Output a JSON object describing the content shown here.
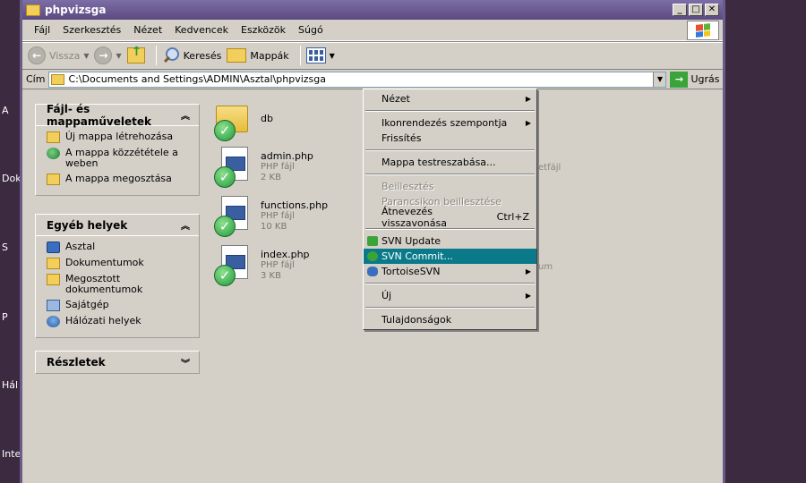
{
  "window": {
    "title": "phpvizsga"
  },
  "desktop_labels": [
    "A",
    "Dok",
    "S",
    "P",
    "Hál",
    "Inte"
  ],
  "menu": [
    "Fájl",
    "Szerkesztés",
    "Nézet",
    "Kedvencek",
    "Eszközök",
    "Súgó"
  ],
  "toolbar": {
    "back": "Vissza",
    "search": "Keresés",
    "folders": "Mappák"
  },
  "address": {
    "label": "Cím",
    "path": "C:\\Documents and Settings\\ADMIN\\Asztal\\phpvizsga",
    "go": "Ugrás"
  },
  "tasks_panel": {
    "title": "Fájl- és mappaműveletek",
    "items": [
      "Új mappa létrehozása",
      "A mappa közzététele a weben",
      "A mappa megosztása"
    ]
  },
  "places_panel": {
    "title": "Egyéb helyek",
    "items": [
      "Asztal",
      "Dokumentumok",
      "Megosztott dokumentumok",
      "Sajátgép",
      "Hálózati helyek"
    ]
  },
  "details_panel": {
    "title": "Részletek"
  },
  "files": [
    {
      "name": "db",
      "type": "",
      "size": ""
    },
    {
      "name": "admin.php",
      "type": "PHP fájl",
      "size": "2 KB"
    },
    {
      "name": "functions.php",
      "type": "PHP fájl",
      "size": "10 KB"
    },
    {
      "name": "index.php",
      "type": "PHP fájl",
      "size": "3 KB"
    }
  ],
  "background_fragments": [
    "etfájl",
    "um"
  ],
  "context_menu": {
    "view": "Nézet",
    "arrange": "Ikonrendezés szempontja",
    "refresh": "Frissítés",
    "customize": "Mappa testreszabása...",
    "paste": "Beillesztés",
    "paste_shortcut": "Parancsikon beillesztése",
    "undo_rename": "Átnevezés visszavonása",
    "undo_shortcut": "Ctrl+Z",
    "svn_update": "SVN Update",
    "svn_commit": "SVN Commit...",
    "tortoise": "TortoiseSVN",
    "new": "Új",
    "properties": "Tulajdonságok"
  }
}
